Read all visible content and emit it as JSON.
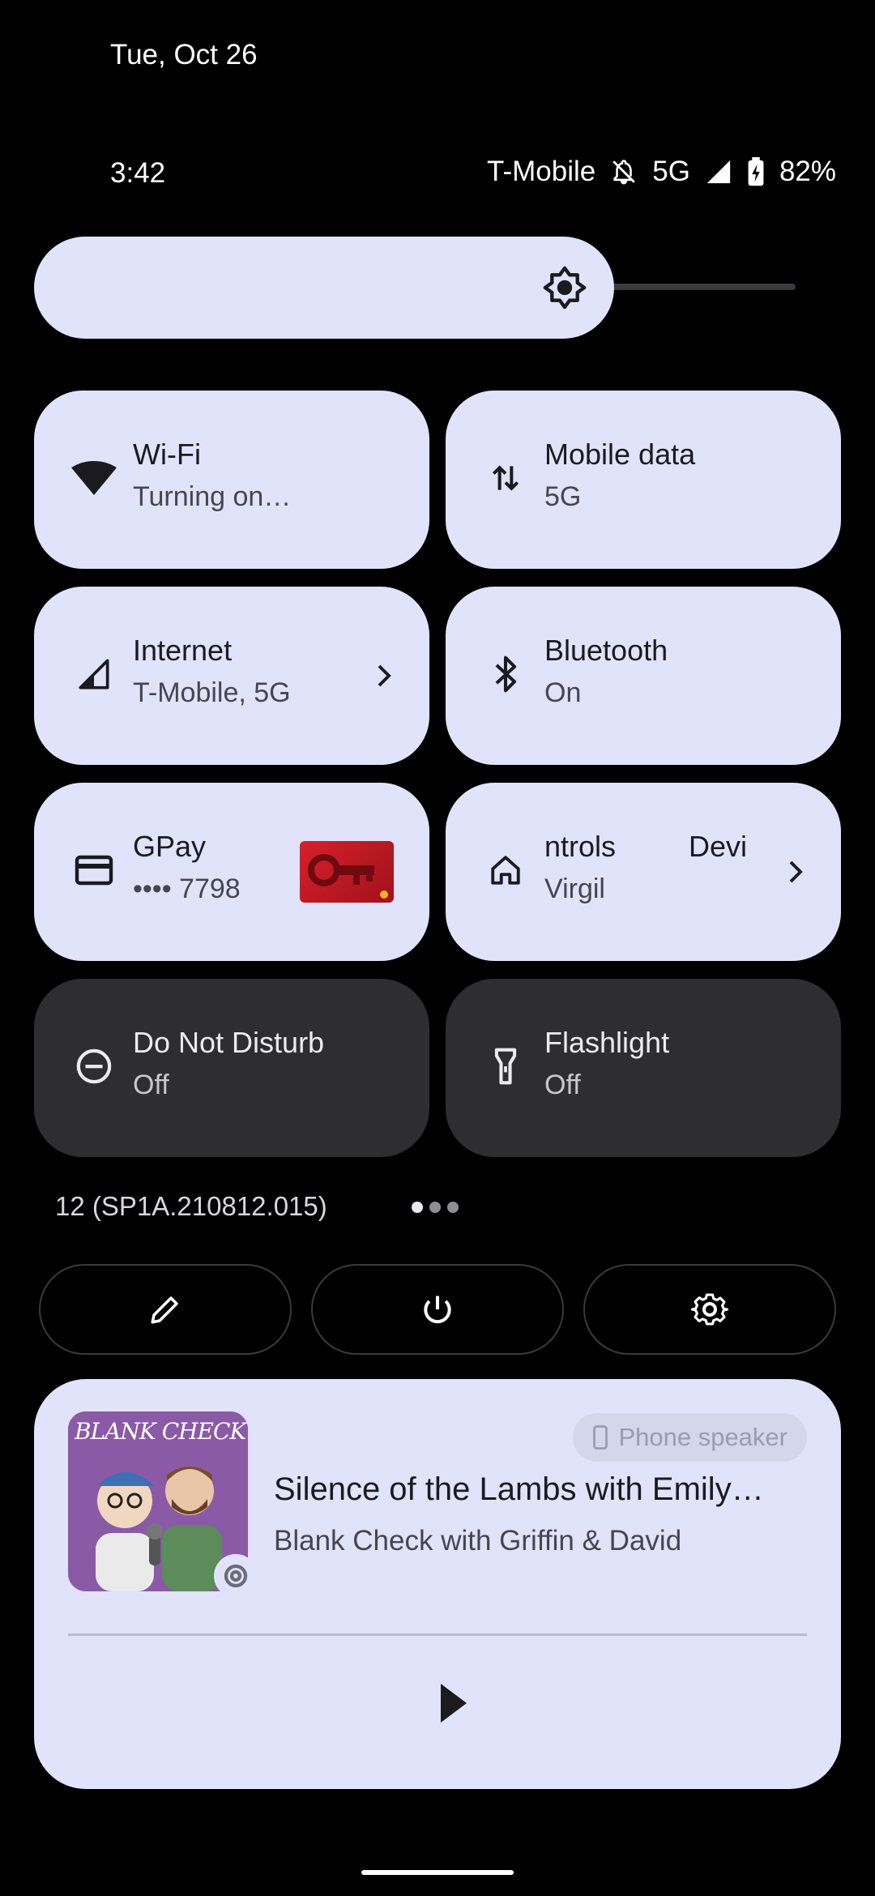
{
  "status": {
    "date": "Tue, Oct 26",
    "time": "3:42",
    "carrier": "T-Mobile",
    "network": "5G",
    "battery": "82%"
  },
  "brightness": {
    "level": 0.66
  },
  "tiles": [
    {
      "title": "Wi-Fi",
      "subtitle": "Turning on…",
      "icon": "wifi-icon",
      "state": "on"
    },
    {
      "title": "Mobile data",
      "subtitle": "5G",
      "icon": "data-arrows-icon",
      "state": "on"
    },
    {
      "title": "Internet",
      "subtitle": "T-Mobile, 5G",
      "icon": "cell-signal-icon",
      "state": "on"
    },
    {
      "title": "Bluetooth",
      "subtitle": "On",
      "icon": "bluetooth-icon",
      "state": "on"
    },
    {
      "title": "GPay",
      "subtitle": "•••• 7798",
      "icon": "card-icon",
      "state": "on"
    },
    {
      "title": "ntrols",
      "title2": "Devi",
      "subtitle": "Virgil",
      "icon": "home-icon",
      "state": "on"
    },
    {
      "title": "Do Not Disturb",
      "subtitle": "Off",
      "icon": "dnd-icon",
      "state": "off"
    },
    {
      "title": "Flashlight",
      "subtitle": "Off",
      "icon": "flashlight-icon",
      "state": "off"
    }
  ],
  "build": "12 (SP1A.210812.015)",
  "page_dots": {
    "count": 3,
    "active": 0
  },
  "media": {
    "title": "Silence of the Lambs with Emily…",
    "subtitle": "Blank Check with Griffin & David",
    "output": "Phone speaker",
    "art_text": "BLANK CHECK"
  },
  "colors": {
    "tile_on": "#e1e3fb",
    "tile_off": "#2e2e30",
    "background": "#000000"
  }
}
